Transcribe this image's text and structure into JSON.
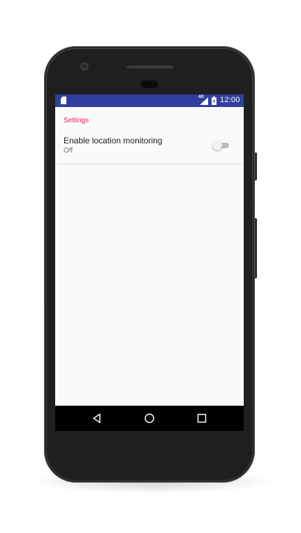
{
  "status_bar": {
    "network_label": "4G",
    "time": "12:00",
    "background_color": "#303f9f",
    "icons": [
      "sd-card-icon",
      "signal-icon",
      "battery-icon"
    ]
  },
  "settings": {
    "category_title": "Settings",
    "category_color": "#e91e63",
    "items": [
      {
        "title": "Enable location monitoring",
        "summary": "Off",
        "switch_on": false
      }
    ]
  },
  "nav_bar": {
    "buttons": [
      "back-icon",
      "home-icon",
      "recents-icon"
    ]
  }
}
